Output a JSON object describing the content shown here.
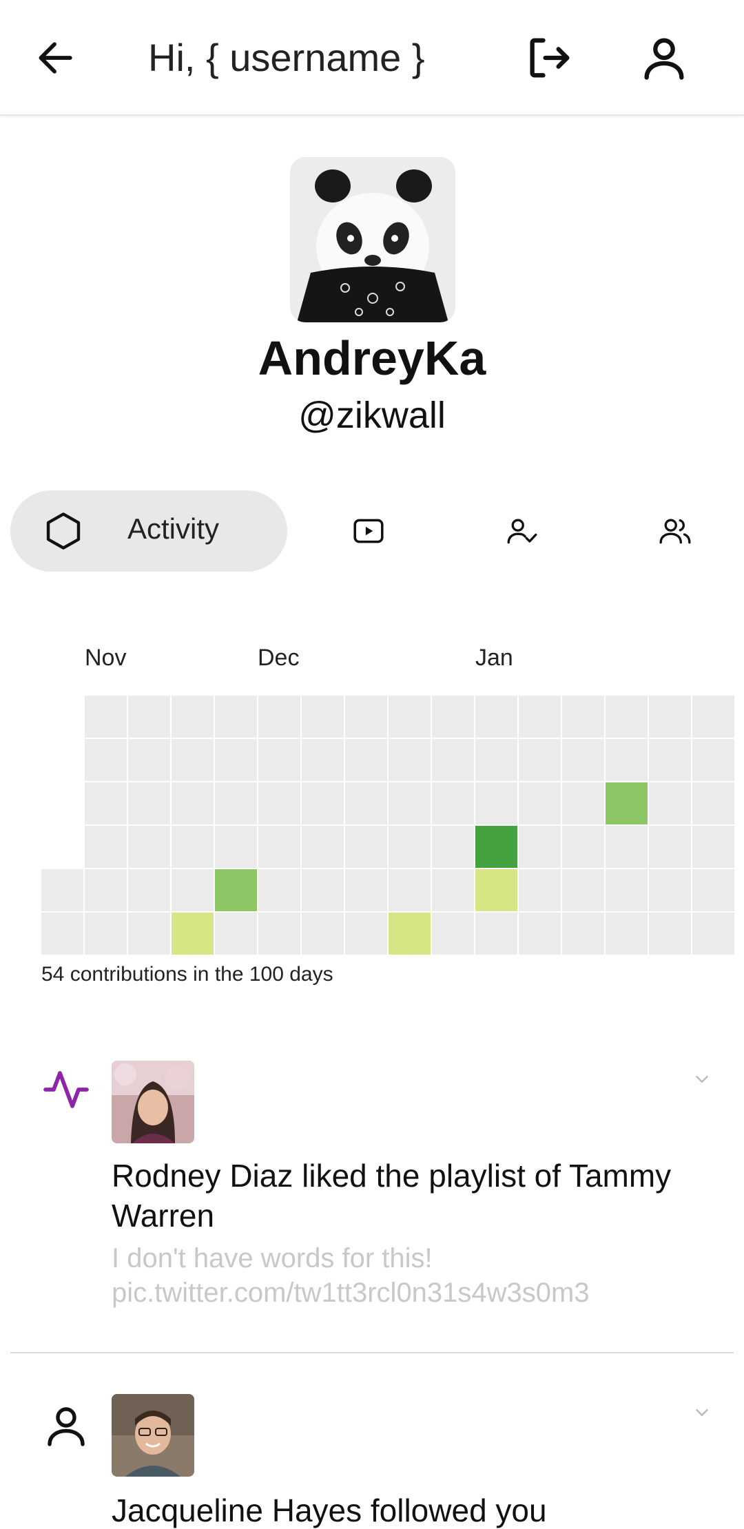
{
  "header": {
    "greeting": "Hi, { username }",
    "back_icon": "arrow-left-icon",
    "logout_icon": "logout-icon",
    "profile_icon": "user-icon"
  },
  "profile": {
    "avatar": "panda-avatar",
    "display_name": "AndreyKa",
    "handle": "@zikwall"
  },
  "tabs": [
    {
      "label": "Activity",
      "icon": "hexagon-icon",
      "active": true
    },
    {
      "label": "",
      "icon": "play-icon",
      "active": false
    },
    {
      "label": "",
      "icon": "user-check-icon",
      "active": false
    },
    {
      "label": "",
      "icon": "users-icon",
      "active": false
    }
  ],
  "contributions": {
    "months": [
      "Nov",
      "Dec",
      "Jan"
    ],
    "caption": "54 contributions in the 100 days",
    "colors": {
      "empty": "#ebebeb",
      "level1": "#d6e685",
      "level2": "#8cc665",
      "level3": "#44a340"
    },
    "weeks": 16,
    "rows": 6,
    "leading_empty": 4,
    "highlights": [
      {
        "week": 4,
        "row": 4,
        "level": 2
      },
      {
        "week": 3,
        "row": 5,
        "level": 1
      },
      {
        "week": 8,
        "row": 5,
        "level": 1
      },
      {
        "week": 10,
        "row": 3,
        "level": 3
      },
      {
        "week": 10,
        "row": 4,
        "level": 1
      },
      {
        "week": 13,
        "row": 2,
        "level": 2
      }
    ]
  },
  "feed": [
    {
      "icon": "activity-icon",
      "avatar": "woman-avatar",
      "title": "Rodney Diaz liked the playlist of Tammy Warren",
      "subtitle": "I don't have words for this! pic.twitter.com/tw1tt3rcl0n31s4w3s0m3",
      "chevron": "chevron-down-icon"
    },
    {
      "icon": "user-icon",
      "avatar": "man-avatar",
      "title": "Jacqueline Hayes followed you",
      "subtitle": "",
      "chevron": "chevron-down-icon"
    }
  ]
}
